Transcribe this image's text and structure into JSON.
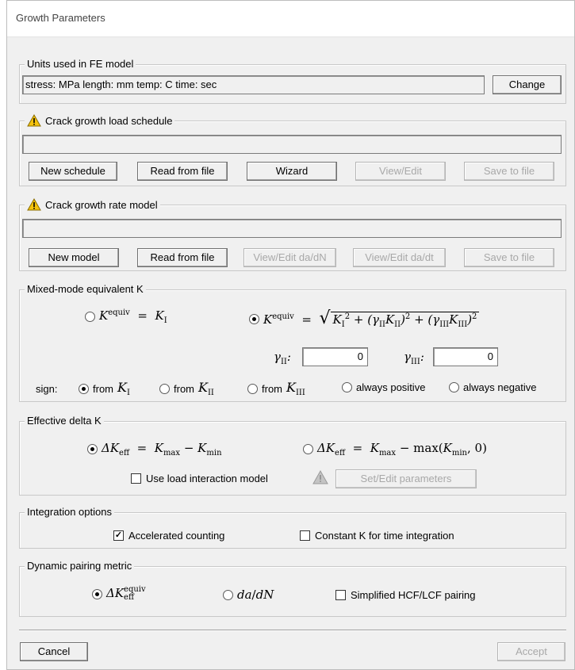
{
  "window": {
    "title": "Growth Parameters"
  },
  "units": {
    "group_label": "Units used in FE model",
    "value": "stress: MPa   length: mm   temp: C   time: sec",
    "change_label": "Change"
  },
  "schedule": {
    "group_label": "Crack growth load schedule",
    "value": "",
    "buttons": {
      "new": "New schedule",
      "read": "Read from file",
      "wizard": "Wizard",
      "view": "View/Edit",
      "save": "Save to file"
    }
  },
  "rate": {
    "group_label": "Crack growth rate model",
    "value": "",
    "buttons": {
      "new": "New model",
      "read": "Read from file",
      "view_dadn": "View/Edit da/dN",
      "view_dadt": "View/Edit da/dt",
      "save": "Save to file"
    }
  },
  "mixed": {
    "group_label": "Mixed-mode equivalent K",
    "gamma_II_value": "0",
    "gamma_III_value": "0",
    "sign_label": "sign:",
    "from_label": "from",
    "always_positive": "always positive",
    "always_negative": "always negative",
    "selected_formula": "sqrt",
    "selected_sign": "from K_I"
  },
  "effective": {
    "group_label": "Effective delta K",
    "use_load_interaction": "Use load interaction model",
    "use_load_interaction_checked": false,
    "set_edit": "Set/Edit parameters",
    "selected": "kmax-kmin"
  },
  "integration": {
    "group_label": "Integration options",
    "accelerated": "Accelerated counting",
    "accelerated_checked": true,
    "constant_k": "Constant K for time integration",
    "constant_k_checked": false
  },
  "dynamic": {
    "group_label": "Dynamic pairing metric",
    "simplified": "Simplified HCF/LCF pairing",
    "simplified_checked": false,
    "selected": "delta-k-eff-equiv"
  },
  "footer": {
    "cancel": "Cancel",
    "accept": "Accept"
  },
  "colors": {
    "warning": "#f4c20d",
    "window_bg": "#f0f0f0",
    "disabled_text": "#a8a8a8"
  }
}
